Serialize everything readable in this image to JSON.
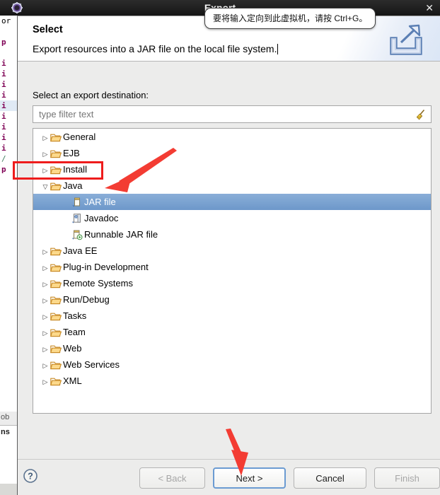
{
  "vm_window": {
    "title": "Export",
    "gear_icon": "vmware-gear-icon",
    "close_label": "✕",
    "tooltip": "要将输入定向到此虚拟机，请按 Ctrl+G。"
  },
  "background_editor": {
    "gutter_lines": [
      "or",
      "p",
      "i",
      "i",
      "i",
      "i",
      "i",
      "i",
      "i",
      "i",
      "i",
      "/",
      "p"
    ],
    "view_tabs": [
      "ob",
      "ns"
    ]
  },
  "dialog": {
    "title": "Select",
    "subtitle": "Export resources into a JAR file on the local file system.",
    "banner_icon": "export-wizard-icon",
    "field_label": "Select an export destination:",
    "filter": {
      "value": "",
      "placeholder": "type filter text",
      "clear_icon": "broom-icon"
    },
    "tree": [
      {
        "label": "General",
        "icon": "folder-icon",
        "state": "collapsed",
        "level": 0,
        "selected": false
      },
      {
        "label": "EJB",
        "icon": "folder-icon",
        "state": "collapsed",
        "level": 0,
        "selected": false
      },
      {
        "label": "Install",
        "icon": "folder-icon",
        "state": "collapsed",
        "level": 0,
        "selected": false
      },
      {
        "label": "Java",
        "icon": "folder-icon",
        "state": "expanded",
        "level": 0,
        "selected": false
      },
      {
        "label": "JAR file",
        "icon": "jar-file-icon",
        "state": "leaf",
        "level": 1,
        "selected": true
      },
      {
        "label": "Javadoc",
        "icon": "javadoc-icon",
        "state": "leaf",
        "level": 1,
        "selected": false
      },
      {
        "label": "Runnable JAR file",
        "icon": "runnable-jar-icon",
        "state": "leaf",
        "level": 1,
        "selected": false
      },
      {
        "label": "Java EE",
        "icon": "folder-icon",
        "state": "collapsed",
        "level": 0,
        "selected": false
      },
      {
        "label": "Plug-in Development",
        "icon": "folder-icon",
        "state": "collapsed",
        "level": 0,
        "selected": false
      },
      {
        "label": "Remote Systems",
        "icon": "folder-icon",
        "state": "collapsed",
        "level": 0,
        "selected": false
      },
      {
        "label": "Run/Debug",
        "icon": "folder-icon",
        "state": "collapsed",
        "level": 0,
        "selected": false
      },
      {
        "label": "Tasks",
        "icon": "folder-icon",
        "state": "collapsed",
        "level": 0,
        "selected": false
      },
      {
        "label": "Team",
        "icon": "folder-icon",
        "state": "collapsed",
        "level": 0,
        "selected": false
      },
      {
        "label": "Web",
        "icon": "folder-icon",
        "state": "collapsed",
        "level": 0,
        "selected": false
      },
      {
        "label": "Web Services",
        "icon": "folder-icon",
        "state": "collapsed",
        "level": 0,
        "selected": false
      },
      {
        "label": "XML",
        "icon": "folder-icon",
        "state": "collapsed",
        "level": 0,
        "selected": false
      }
    ],
    "footer": {
      "help_icon": "help-question-icon",
      "buttons": [
        {
          "id": "back",
          "label": "< Back",
          "enabled": false,
          "default": false
        },
        {
          "id": "next",
          "label": "Next >",
          "enabled": true,
          "default": true
        },
        {
          "id": "cancel",
          "label": "Cancel",
          "enabled": true,
          "default": false
        },
        {
          "id": "finish",
          "label": "Finish",
          "enabled": false,
          "default": false
        }
      ]
    }
  },
  "annotations": {
    "highlight_target": "Java",
    "arrow_to_jar_file": "red-arrow-icon",
    "arrow_to_next_button": "red-arrow-icon",
    "accent_color": "#ee1c1c",
    "selection_color": "#6d98ca"
  }
}
